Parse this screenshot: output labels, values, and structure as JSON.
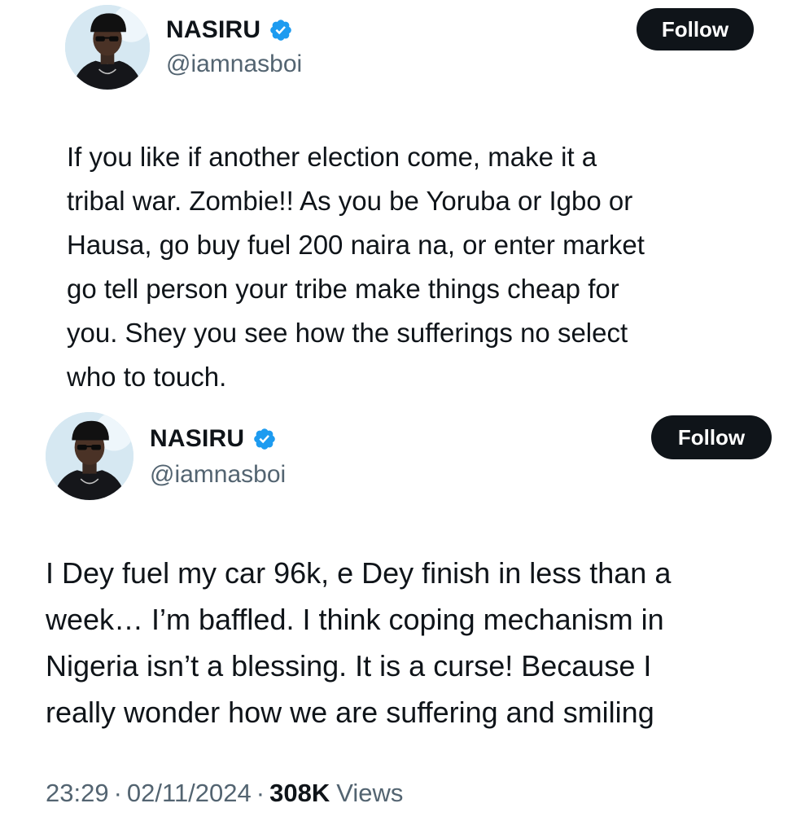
{
  "colors": {
    "text_primary": "#0f1419",
    "text_secondary": "#536471",
    "verified_blue": "#1d9bf0",
    "follow_bg": "#0f1419"
  },
  "tweets": [
    {
      "author": {
        "display_name": "NASIRU",
        "handle": "@iamnasboi",
        "verified_icon": "verified-badge-icon",
        "avatar": "profile-photo"
      },
      "follow_label": "Follow",
      "text": "If you like if another election come, make it a\ntribal war. Zombie!! As you be Yoruba or Igbo or\nHausa, go buy fuel 200 naira na, or enter market\ngo tell person your tribe make things cheap for\nyou. Shey you see how the sufferings no select\nwho to touch."
    },
    {
      "author": {
        "display_name": "NASIRU",
        "handle": "@iamnasboi",
        "verified_icon": "verified-badge-icon",
        "avatar": "profile-photo"
      },
      "follow_label": "Follow",
      "text": "I Dey fuel my car 96k, e Dey finish in less than a\nweek… I’m baffled. I think coping mechanism in\nNigeria isn’t a blessing. It is a curse! Because I\nreally wonder how we are suffering and smiling",
      "meta": {
        "time": "23:29",
        "separator": "·",
        "date": "02/11/2024",
        "views_count": "308K",
        "views_label": "Views"
      }
    }
  ]
}
